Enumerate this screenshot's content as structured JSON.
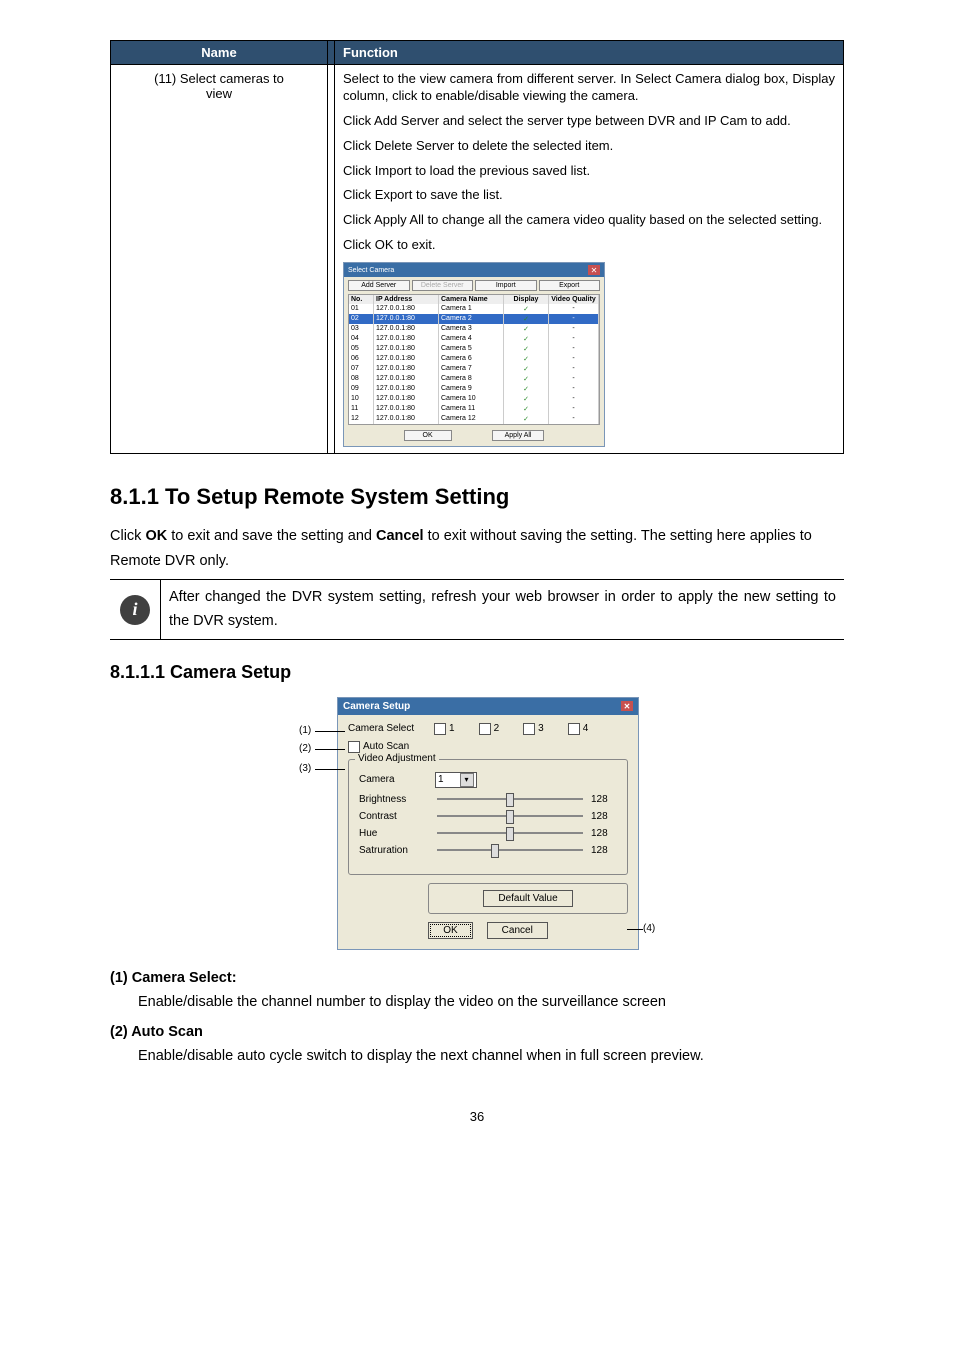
{
  "table": {
    "head": {
      "name": "Name",
      "sep": "",
      "function": "Function"
    },
    "row_name_1": "(11) Select cameras to",
    "row_name_2": "view",
    "f1": "Select to the view camera from different server. In Select Camera dialog box, Display column, click to enable/disable viewing the camera.",
    "f2": "Click Add Server and select the server type between DVR and IP Cam to add.",
    "f3": "Click Delete Server to delete the selected item.",
    "f4": "Click Import to load the previous saved list.",
    "f5": "Click Export to save the list.",
    "f6": "Click Apply All to change all the camera video quality based on the selected setting.",
    "f7": "Click OK to exit.",
    "dlg": {
      "title": "Select Camera",
      "add": "Add Server",
      "del": "Delete Server",
      "import": "Import",
      "export": "Export",
      "hdr": {
        "no": "No.",
        "ip": "IP Address",
        "name": "Camera Name",
        "disp": "Display",
        "vq": "Video Quality"
      },
      "rows": [
        {
          "no": "01",
          "ip": "127.0.0.1:80",
          "name": "Camera 1"
        },
        {
          "no": "02",
          "ip": "127.0.0.1:80",
          "name": "Camera 2"
        },
        {
          "no": "03",
          "ip": "127.0.0.1:80",
          "name": "Camera 3"
        },
        {
          "no": "04",
          "ip": "127.0.0.1:80",
          "name": "Camera 4"
        },
        {
          "no": "05",
          "ip": "127.0.0.1:80",
          "name": "Camera 5"
        },
        {
          "no": "06",
          "ip": "127.0.0.1:80",
          "name": "Camera 6"
        },
        {
          "no": "07",
          "ip": "127.0.0.1:80",
          "name": "Camera 7"
        },
        {
          "no": "08",
          "ip": "127.0.0.1:80",
          "name": "Camera 8"
        },
        {
          "no": "09",
          "ip": "127.0.0.1:80",
          "name": "Camera 9"
        },
        {
          "no": "10",
          "ip": "127.0.0.1:80",
          "name": "Camera 10"
        },
        {
          "no": "11",
          "ip": "127.0.0.1:80",
          "name": "Camera 11"
        },
        {
          "no": "12",
          "ip": "127.0.0.1:80",
          "name": "Camera 12"
        }
      ],
      "ok": "OK",
      "apply": "Apply All"
    }
  },
  "sec811": "8.1.1  To Setup Remote System Setting",
  "body": {
    "p1a": "Click ",
    "p1b": "OK",
    "p1c": " to exit and save the setting and ",
    "p1d": "Cancel",
    "p1e": " to exit without saving the setting. The setting here applies to Remote DVR only."
  },
  "info": "After changed the DVR system setting, refresh your web browser in order to apply the new setting to the DVR system.",
  "sec8111": "8.1.1.1 Camera Setup",
  "cs": {
    "title": "Camera Setup",
    "select_lbl": "Camera Select",
    "cb1": "1",
    "cb2": "2",
    "cb3": "3",
    "cb4": "4",
    "autoscan": "Auto Scan",
    "video_adj": "Video Adjustment",
    "camera": "Camera",
    "camera_val": "1",
    "brightness": "Brightness",
    "brightness_v": "128",
    "contrast": "Contrast",
    "contrast_v": "128",
    "hue": "Hue",
    "hue_v": "128",
    "sat": "Satruration",
    "sat_v": "128",
    "defval": "Default Value",
    "ok": "OK",
    "cancel": "Cancel",
    "co1": "(1)",
    "co2": "(2)",
    "co3": "(3)",
    "co4": "(4)"
  },
  "fn1_head": "(1) Camera Select:",
  "fn1_body": "Enable/disable the channel number to display the video on the surveillance screen",
  "fn2_head": "(2) Auto Scan",
  "fn2_body": "Enable/disable auto cycle switch to display the next channel when in full screen preview.",
  "page_num": "36"
}
